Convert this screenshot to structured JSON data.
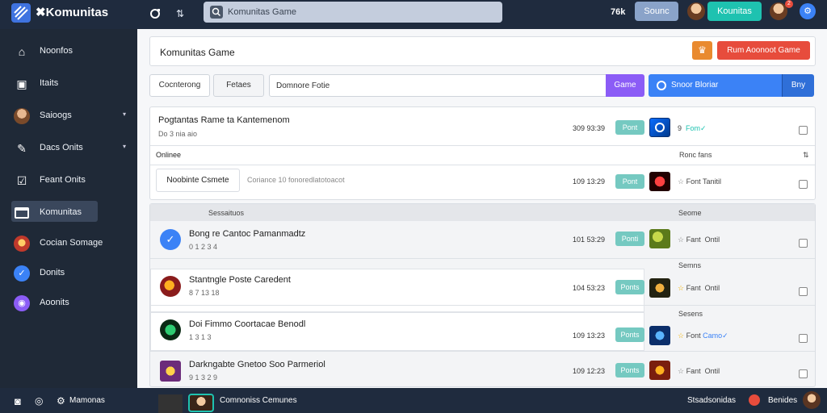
{
  "app": {
    "title": "Komunitas"
  },
  "topbar": {
    "search_placeholder": "Komunitas Game",
    "count": "76k",
    "pill1": "Sounc",
    "pill2": "Kounitas",
    "notif": "2"
  },
  "sidebar": {
    "items": [
      {
        "label": "Noonfos",
        "icon": "home-icon"
      },
      {
        "label": "Itaits",
        "icon": "inbox-icon"
      },
      {
        "label": "Saioogs",
        "icon": "user-avatar-icon"
      },
      {
        "label": "Dacs Onits",
        "icon": "pen-icon"
      },
      {
        "label": "Feant Onits",
        "icon": "checkbox-icon"
      },
      {
        "label": "Komunitas",
        "icon": "window-icon"
      },
      {
        "label": "Cocian Somage",
        "icon": "game-icon"
      },
      {
        "label": "Donits",
        "icon": "verified-icon"
      },
      {
        "label": "Aoonits",
        "icon": "user-circle-icon"
      }
    ]
  },
  "header": {
    "title": "Komunitas Game",
    "action_label": "Rum Aoonoot Game"
  },
  "toolbar": {
    "tabs": [
      "Cocnterong",
      "Fetaes"
    ],
    "filter_placeholder": "Domnore Fotie",
    "game_button": "Game",
    "search_button": "Snoor Bloriar",
    "buy_button": "Bny"
  },
  "top_card": {
    "title": "Pogtantas Rame ta Kantemenom",
    "subtitle": "Do 3 nia aio",
    "meta": "309 93:39",
    "pill": "Pont",
    "right_prefix": "9",
    "right_highlight": "Fom",
    "section_label": "Onlinee",
    "section_right": "Ronc fans",
    "nested_button": "Noobinte Csmete",
    "nested_desc": "Coriance 10 fonoredlatotoacot",
    "nested_meta": "109 13:29",
    "nested_pill": "Pont",
    "nested_right": "Font Tanitil"
  },
  "list": {
    "header_left": "Sessaituos",
    "header_right": "Seome",
    "rows": [
      {
        "title": "Bong re Cantoc Pamanmadtz",
        "subtitle": "0 1 2 3 4",
        "meta": "101 53:29",
        "pill": "Ponti",
        "prefix": "",
        "right_a": "Fant",
        "right_b": "Ontil",
        "hl": "",
        "star": false
      },
      {
        "title": "Stantngle Poste Caredent",
        "subtitle": "8 7 13 18",
        "meta": "104 53:23",
        "pill": "Ponts",
        "prefix": "",
        "right_a": "Fant",
        "right_b": "Ontil",
        "hl": "",
        "star": true
      },
      {
        "title": "Doi Fimmo Coortacae Benodl",
        "subtitle": "1 3 1 3",
        "meta": "109 13:23",
        "pill": "Ponts",
        "prefix": "",
        "right_a": "Font",
        "right_b": "",
        "hl": "Camo",
        "star": true
      },
      {
        "title": "Darkngabte Gnetoo Soo Parmeriol",
        "subtitle": "9 1 3 2 9",
        "meta": "109 12:23",
        "pill": "Ponts",
        "prefix": "",
        "right_a": "Fant",
        "right_b": "Ontil",
        "hl": "",
        "star": false
      }
    ],
    "sublabels": [
      "Semns",
      "Sesens"
    ]
  },
  "bottombar": {
    "left_label": "Mamonas",
    "center_label": "Comnoniss Cemunes",
    "right_label": "Stsadsonidas",
    "right_name": "Benides"
  },
  "colors": {
    "topbar": "#1f2b3e",
    "sidebar": "#1f2937",
    "accent_teal": "#1ec2b0",
    "accent_red": "#e74c3c",
    "accent_purple": "#8b5cf6",
    "accent_blue": "#3b82f6"
  }
}
